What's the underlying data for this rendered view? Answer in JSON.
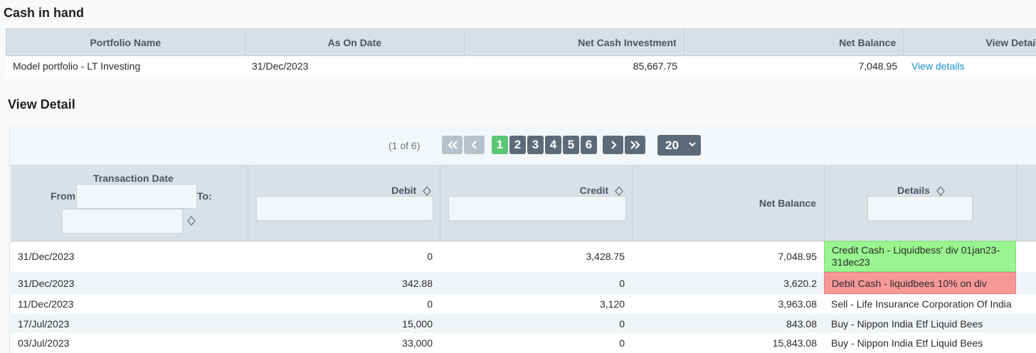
{
  "page": {
    "title": "Cash in hand"
  },
  "summary": {
    "headers": [
      "Portfolio Name",
      "As On Date",
      "Net Cash Investment",
      "Net Balance",
      "View Details"
    ],
    "row": {
      "portfolio_name": "Model portfolio - LT Investing",
      "as_on_date": "31/Dec/2023",
      "net_cash_investment": "85,667.75",
      "net_balance": "7,048.95",
      "view_link": "View details"
    }
  },
  "detail": {
    "title": "View Detail",
    "paginator": {
      "report": "(1 of 6)",
      "pages": [
        "1",
        "2",
        "3",
        "4",
        "5",
        "6"
      ],
      "current_page": "1",
      "rows_per_page": "20"
    },
    "columns": {
      "date": "Transaction Date",
      "from": "From:",
      "to": "To:",
      "debit": "Debit",
      "credit": "Credit",
      "net_balance": "Net Balance",
      "details": "Details"
    },
    "rows": [
      {
        "date": "31/Dec/2023",
        "debit": "0",
        "credit": "3,428.75",
        "net_balance": "7,048.95",
        "details": "Credit Cash - Liquidbess' div 01jan23-31dec23",
        "highlight": "green"
      },
      {
        "date": "31/Dec/2023",
        "debit": "342.88",
        "credit": "0",
        "net_balance": "3,620.2",
        "details": "Debit Cash - liquidbees 10% on div",
        "highlight": "red"
      },
      {
        "date": "11/Dec/2023",
        "debit": "0",
        "credit": "3,120",
        "net_balance": "3,963.08",
        "details": "Sell - Life Insurance Corporation Of India",
        "highlight": ""
      },
      {
        "date": "17/Jul/2023",
        "debit": "15,000",
        "credit": "0",
        "net_balance": "843.08",
        "details": "Buy - Nippon India Etf Liquid Bees",
        "highlight": ""
      },
      {
        "date": "03/Jul/2023",
        "debit": "33,000",
        "credit": "0",
        "net_balance": "15,843.08",
        "details": "Buy - Nippon India Etf Liquid Bees",
        "highlight": ""
      }
    ]
  },
  "colors": {
    "active_page": "#5ac776",
    "paginator_button": "#5b6b79",
    "credit_highlight": "#99f58f",
    "debit_highlight": "#f79898",
    "link": "#1a8ed1"
  }
}
